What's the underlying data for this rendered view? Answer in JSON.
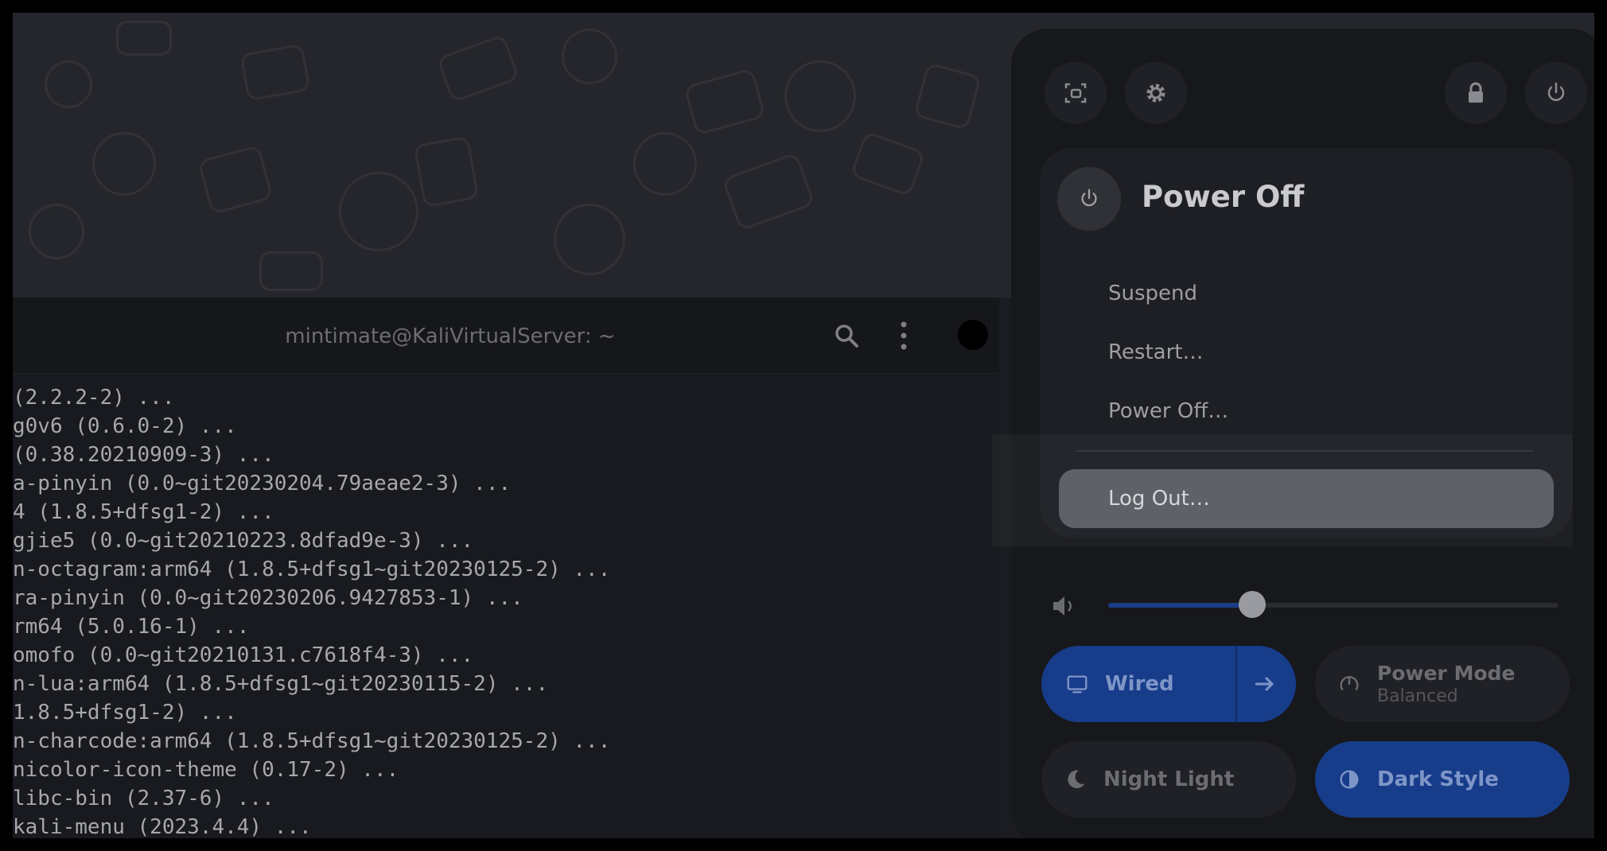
{
  "terminal": {
    "title": "mintimate@KaliVirtualServer: ~",
    "lines": [
      "(2.2.2-2) ...",
      "g0v6 (0.6.0-2) ...",
      "(0.38.20210909-3) ...",
      "a-pinyin (0.0~git20230204.79aeae2-3) ...",
      "4 (1.8.5+dfsg1-2) ...",
      "gjie5 (0.0~git20210223.8dfad9e-3) ...",
      "n-octagram:arm64 (1.8.5+dfsg1~git20230125-2) ...",
      "ra-pinyin (0.0~git20230206.9427853-1) ...",
      "rm64 (5.0.16-1) ...",
      "omofo (0.0~git20210131.c7618f4-3) ...",
      "n-lua:arm64 (1.8.5+dfsg1~git20230115-2) ...",
      "1.8.5+dfsg1-2) ...",
      "n-charcode:arm64 (1.8.5+dfsg1~git20230125-2) ...",
      "nicolor-icon-theme (0.17-2) ...",
      "libc-bin (2.37-6) ...",
      "kali-menu (2023.4.4) ..."
    ],
    "icons": {
      "search": "search-icon",
      "menu": "kebab-menu-icon",
      "close": "close-icon"
    }
  },
  "quick_settings": {
    "top_buttons": [
      {
        "icon": "screenshot-icon",
        "name": "screenshot-button"
      },
      {
        "icon": "gear-icon",
        "name": "settings-button"
      },
      {
        "icon": "lock-icon",
        "name": "lock-button"
      },
      {
        "icon": "power-icon",
        "name": "power-button"
      }
    ],
    "power_menu": {
      "title": "Power Off",
      "items": [
        "Suspend",
        "Restart…",
        "Power Off…"
      ],
      "log_out": "Log Out…"
    },
    "volume": {
      "icon": "speaker-icon",
      "level": 0.32
    },
    "tiles": {
      "wired": {
        "label": "Wired",
        "active": true
      },
      "power_mode": {
        "label": "Power Mode",
        "sublabel": "Balanced",
        "active": false
      },
      "night_light": {
        "label": "Night Light",
        "active": false
      },
      "dark_style": {
        "label": "Dark Style",
        "active": true
      }
    },
    "colors": {
      "accent": "#173c8a",
      "panel": "#17181c",
      "menu": "#1e1f24"
    }
  }
}
